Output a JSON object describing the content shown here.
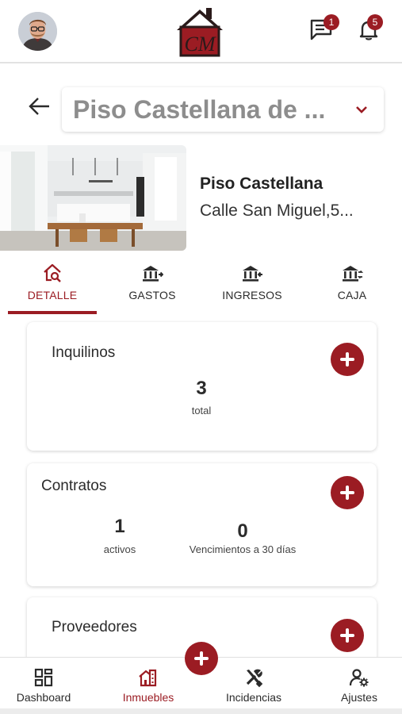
{
  "topbar": {
    "avatar_icon": "user-avatar",
    "logo_text": "CM",
    "messages_icon": "chat-icon",
    "messages_count": "1",
    "notifications_icon": "bell-icon",
    "notifications_count": "5"
  },
  "header": {
    "back_icon": "arrow-left-icon",
    "property_selector": "Piso Castellana de ...",
    "dropdown_icon": "chevron-down-icon"
  },
  "property": {
    "photo": "kitchen-photo",
    "name": "Piso Castellana",
    "address": "Calle San Miguel,5..."
  },
  "tabs": [
    {
      "label": "DETALLE",
      "icon": "house-search-icon",
      "active": true
    },
    {
      "label": "GASTOS",
      "icon": "bank-out-icon",
      "active": false
    },
    {
      "label": "INGRESOS",
      "icon": "bank-in-icon",
      "active": false
    },
    {
      "label": "CAJA",
      "icon": "bank-exchange-icon",
      "active": false
    }
  ],
  "cards": {
    "inquilinos": {
      "title": "Inquilinos",
      "count": "3",
      "count_label": "total"
    },
    "contratos": {
      "title": "Contratos",
      "activos": "1",
      "activos_label": "activos",
      "vencimientos": "0",
      "vencimientos_label": "Vencimientos a 30 días"
    },
    "proveedores": {
      "title": "Proveedores"
    }
  },
  "bottom_nav": [
    {
      "label": "Dashboard",
      "icon": "grid-icon",
      "active": false
    },
    {
      "label": "Inmuebles",
      "icon": "building-icon",
      "active": true
    },
    {
      "label": "Incidencias",
      "icon": "tools-icon",
      "active": false
    },
    {
      "label": "Ajustes",
      "icon": "user-settings-icon",
      "active": false
    }
  ],
  "colors": {
    "accent": "#9b1c23",
    "text": "#2b2b2b",
    "muted": "#8d8d8d"
  }
}
